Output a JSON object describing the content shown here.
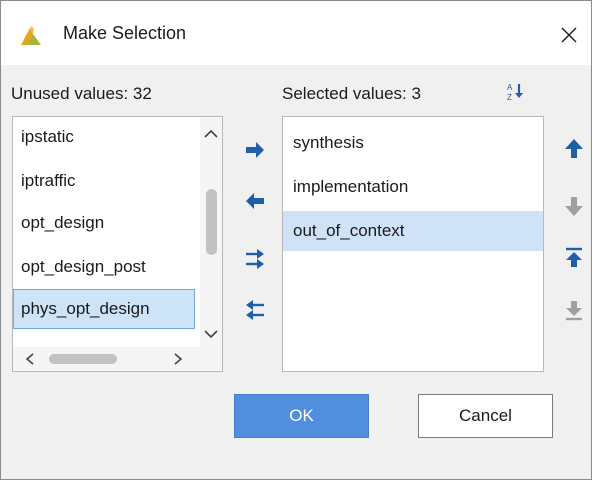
{
  "window": {
    "title": "Make Selection",
    "close_icon": "close-icon",
    "app_icon": "vivado-logo-icon"
  },
  "unused": {
    "label": "Unused values: 32",
    "items": [
      "ipstatic",
      "iptraffic",
      "opt_design",
      "opt_design_post",
      "phys_opt_design"
    ],
    "selected_item": "phys_opt_design"
  },
  "selected": {
    "label": "Selected values: 3",
    "sort_icon": "sort-az-icon",
    "items": [
      "synthesis",
      "implementation",
      "out_of_context"
    ],
    "highlighted_item": "out_of_context"
  },
  "middle_buttons": [
    "move-right-icon",
    "move-left-icon",
    "move-all-right-icon",
    "move-all-left-icon"
  ],
  "side_buttons": [
    "move-up-icon",
    "move-down-icon",
    "move-to-top-icon",
    "move-to-bottom-icon"
  ],
  "buttons": {
    "ok": "OK",
    "cancel": "Cancel"
  },
  "colors": {
    "accent": "#4f8fde",
    "selection": "#cfe2f8",
    "icon_active": "#1f5fa8",
    "icon_disabled": "#a0a0a0"
  }
}
